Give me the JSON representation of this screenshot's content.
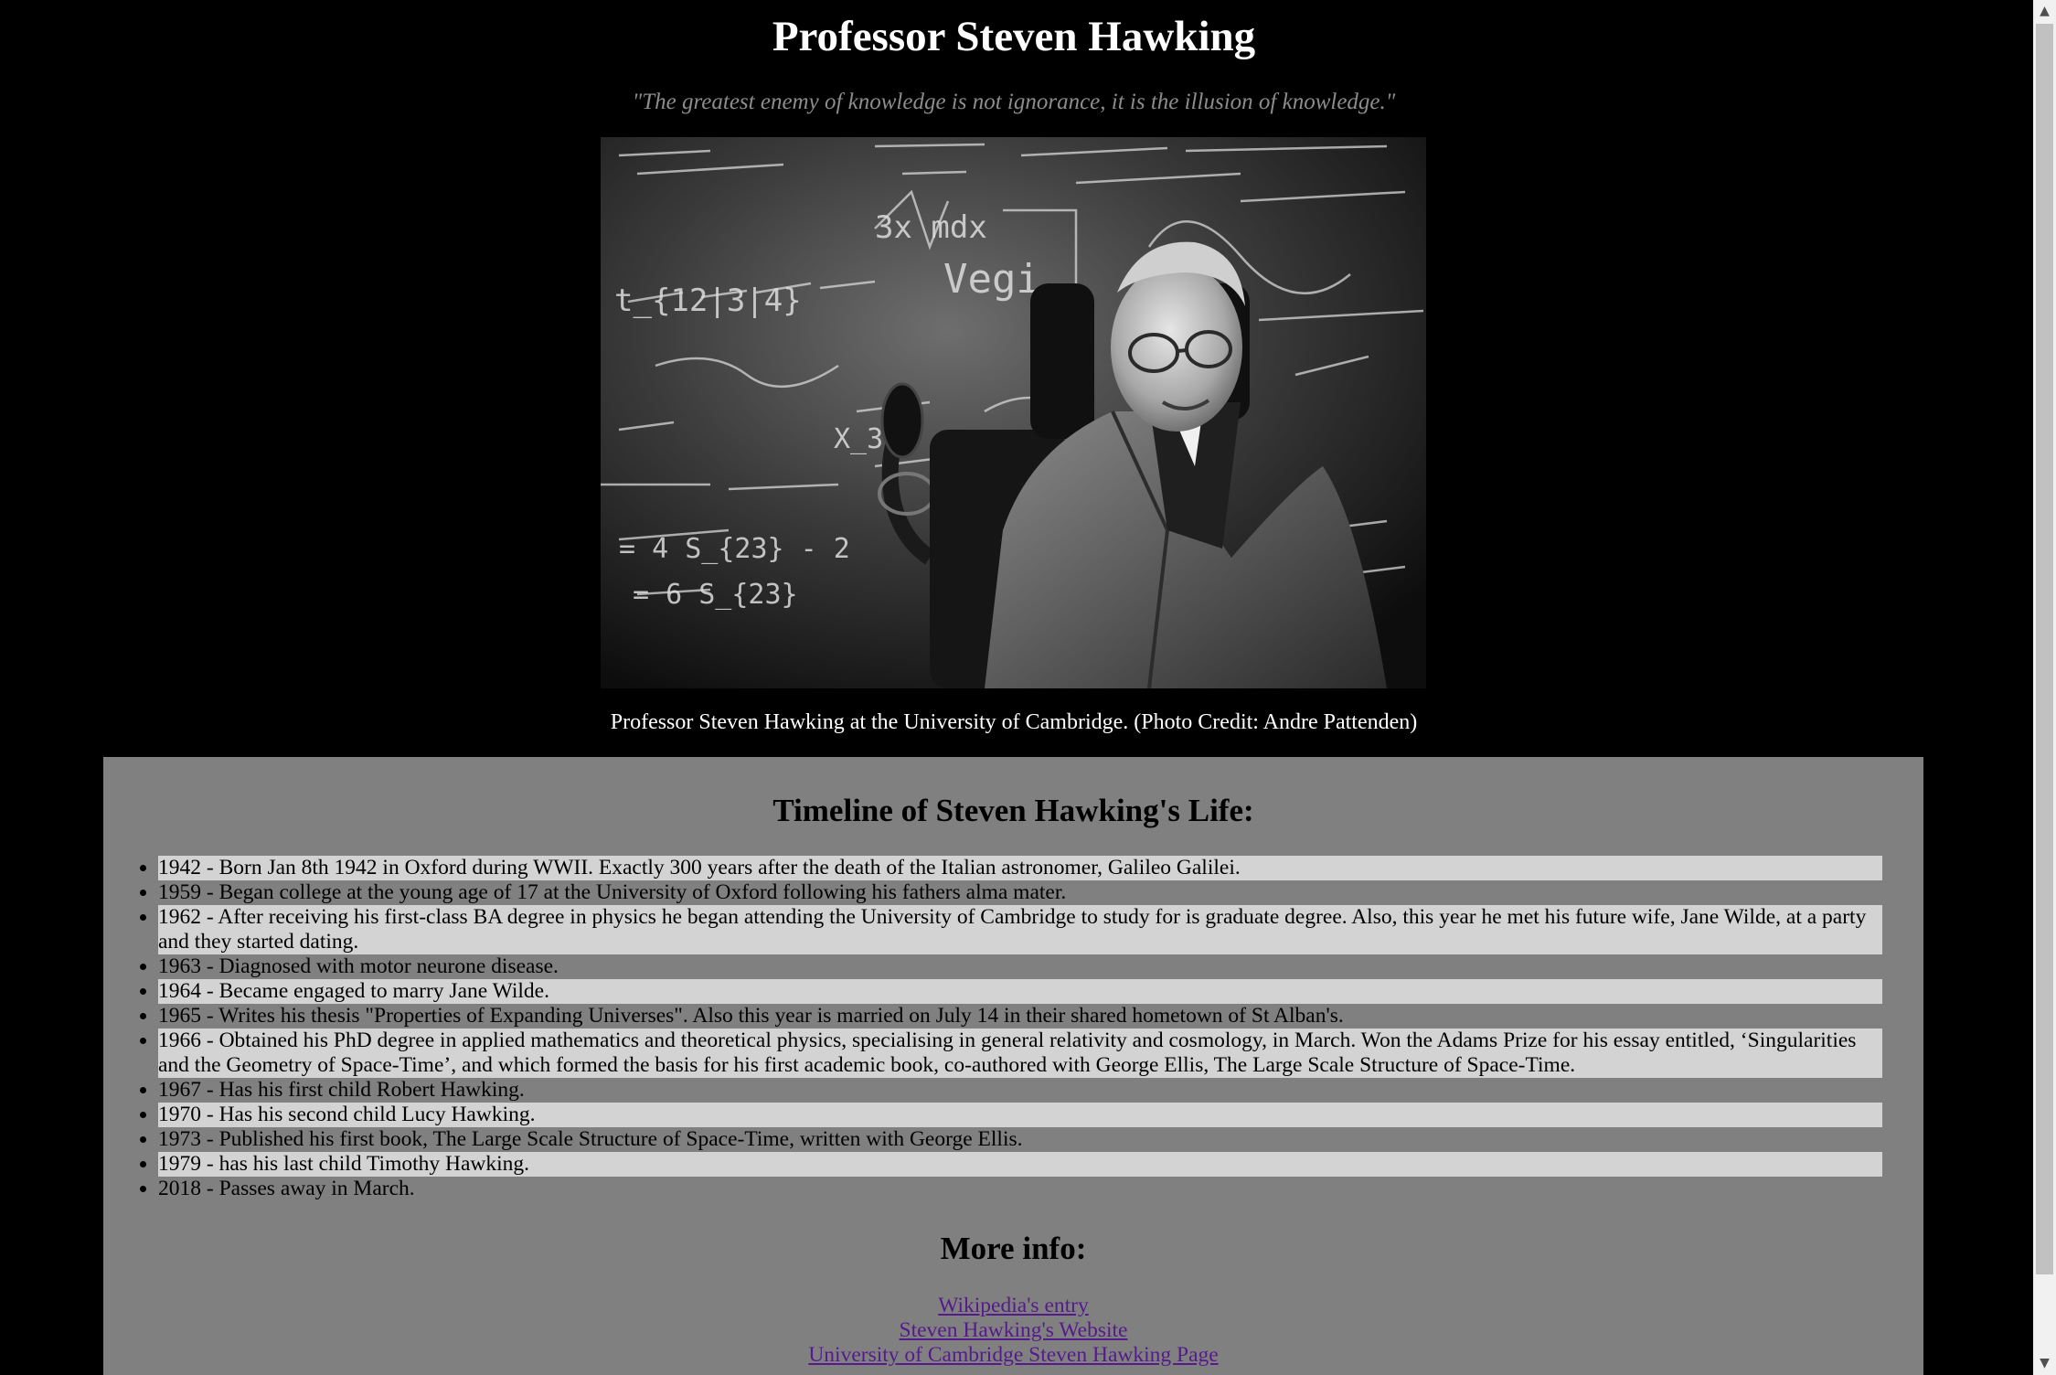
{
  "header": {
    "title": "Professor Steven Hawking",
    "quote": "\"The greatest enemy of knowledge is not ignorance, it is the illusion of knowledge.\""
  },
  "photo": {
    "caption": "Professor Steven Hawking at the University of Cambridge. (Photo Credit: Andre Pattenden)",
    "chalkboard_text": [
      "3x mdx",
      "Vegi",
      "t_{12|3|4}",
      "X_3",
      "= 4 S_{23} - 2",
      "= 6 S_{23}"
    ]
  },
  "timeline": {
    "heading": "Timeline of Steven Hawking's Life:",
    "items": [
      "1942 - Born Jan 8th 1942 in Oxford during WWII. Exactly 300 years after the death of the Italian astronomer, Galileo Galilei.",
      "1959 - Began college at the young age of 17 at the University of Oxford following his fathers alma mater.",
      "1962 - After receiving his first-class BA degree in physics he began attending the University of Cambridge to study for is graduate degree. Also, this year he met his future wife, Jane Wilde, at a party and they started dating.",
      "1963 - Diagnosed with motor neurone disease.",
      "1964 - Became engaged to marry Jane Wilde.",
      "1965 - Writes his thesis \"Properties of Expanding Universes\". Also this year is married on July 14 in their shared hometown of St Alban's.",
      "1966 - Obtained his PhD degree in applied mathematics and theoretical physics, specialising in general relativity and cosmology, in March. Won the Adams Prize for his essay entitled, ‘Singularities and the Geometry of Space-Time’, and which formed the basis for his first academic book, co-authored with George Ellis, The Large Scale Structure of Space-Time.",
      "1967 - Has his first child Robert Hawking.",
      "1970 - Has his second child Lucy Hawking.",
      "1973 - Published his first book, The Large Scale Structure of Space-Time, written with George Ellis.",
      "1979 - has his last child Timothy Hawking.",
      "2018 - Passes away in March."
    ]
  },
  "more_info": {
    "heading": "More info:",
    "links": [
      "Wikipedia's entry",
      "Steven Hawking's Website",
      "University of Cambridge Steven Hawking Page"
    ]
  },
  "icons": {
    "scroll_up": "scroll-up-arrow",
    "scroll_down": "scroll-down-arrow"
  },
  "colors": {
    "page_background": "#000000",
    "panel_background": "#808080",
    "stripe_background": "#d3d3d3",
    "quote_text": "#8c8c8c",
    "link": "#551a8b"
  }
}
